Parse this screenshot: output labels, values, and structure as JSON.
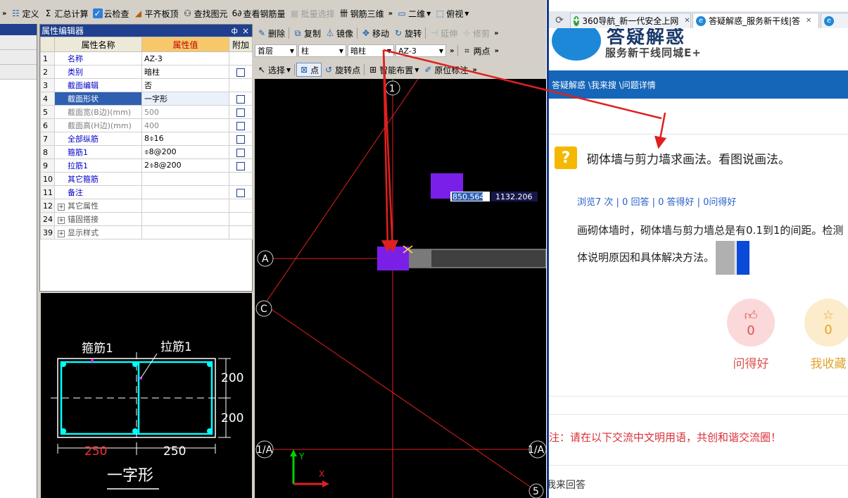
{
  "app": {
    "top_toolbar": {
      "chevron": "»",
      "define": "定义",
      "sum_calc": "汇总计算",
      "cloud_check": "云检查",
      "align_top": "平齐板顶",
      "find_element": "查找图元",
      "view_rebar_qty": "查看钢筋量",
      "batch_select": "批量选择",
      "rebar_3d": "钢筋三维",
      "view_2d": "二维",
      "top_view": "俯视"
    },
    "property_editor": {
      "title": "属性编辑器",
      "pin": "ф",
      "close": "×",
      "columns": [
        "属性名称",
        "属性值",
        "附加"
      ],
      "rows": [
        {
          "no": "1",
          "name": "名称",
          "value": "AZ-3",
          "check": false,
          "grey": false
        },
        {
          "no": "2",
          "name": "类别",
          "value": "暗柱",
          "check": true,
          "grey": false
        },
        {
          "no": "3",
          "name": "截面编辑",
          "value": "否",
          "check": false,
          "grey": false
        },
        {
          "no": "4",
          "name": "截面形状",
          "value": "一字形",
          "check": true,
          "grey": false,
          "selected": true
        },
        {
          "no": "5",
          "name": "截面宽(B边)(mm)",
          "value": "500",
          "check": true,
          "grey": true
        },
        {
          "no": "6",
          "name": "截面高(H边)(mm)",
          "value": "400",
          "check": true,
          "grey": true
        },
        {
          "no": "7",
          "name": "全部纵筋",
          "value": "8⌽16",
          "check": true,
          "grey": false
        },
        {
          "no": "8",
          "name": "箍筋1",
          "value": "⌽8@200",
          "check": true,
          "grey": false
        },
        {
          "no": "9",
          "name": "拉筋1",
          "value": "2⌽8@200",
          "check": true,
          "grey": false
        },
        {
          "no": "10",
          "name": "其它箍筋",
          "value": "",
          "check": false,
          "grey": false
        },
        {
          "no": "11",
          "name": "备注",
          "value": "",
          "check": true,
          "grey": false
        }
      ],
      "groups": [
        {
          "no": "12",
          "name": "其它属性"
        },
        {
          "no": "24",
          "name": "锚固搭接"
        },
        {
          "no": "39",
          "name": "显示样式"
        }
      ]
    },
    "preview": {
      "label_stirrup": "箍筋1",
      "label_tie": "拉筋1",
      "dim_h1": "200",
      "dim_h2": "200",
      "dim_w1": "250",
      "dim_w2": "250",
      "shape_name": "一字形"
    },
    "cad_toolbar": {
      "delete": "删除",
      "copy": "复制",
      "mirror": "镜像",
      "move": "移动",
      "rotate": "旋转",
      "extend": "延伸",
      "trim": "修剪",
      "floor": "首层",
      "element_type": "柱",
      "sub_type": "暗柱",
      "component": "AZ-3",
      "two_points": "两点",
      "select": "选择",
      "point": "点",
      "rotate_point": "旋转点",
      "smart_place": "智能布置",
      "origin_mark": "原位标注"
    },
    "canvas": {
      "axis_1": "1",
      "axis_A": "A",
      "axis_C": "C",
      "axis_1A": "1/A",
      "axis_5": "5",
      "coord_x": "850.564",
      "coord_y": "1132.206",
      "ucs_y": "Y",
      "ucs_x": "X"
    }
  },
  "browser": {
    "tabs": [
      {
        "label": "360导航_新一代安全上网"
      },
      {
        "label": "答疑解惑_服务新干线|答"
      },
      {
        "label": ""
      }
    ],
    "site_title": "答疑解惑",
    "site_subtitle": "服务新干线同城E+",
    "breadcrumb": "答疑解惑 \\我来搜 \\问题详情",
    "question_title": "砌体墙与剪力墙求画法。看图说画法。",
    "stats": "浏览7 次 | 0 回答 | 0 答得好 | 0问得好",
    "desc_line1": "画砌体墙时，砌体墙与剪力墙总是有0.1到1的间距。检测",
    "desc_line2": "体说明原因和具体解决方法。",
    "good_count": "0",
    "good_label": "问得好",
    "fav_count": "0",
    "fav_label": "我收藏",
    "notice": "注：请在以下交流中文明用语，共创和谐交流圈！",
    "answer_tab": "我来回答"
  },
  "colors": {
    "annotation_arrow": "#e02020",
    "column_fill": "#7a1fe8",
    "site_blue": "#1565b8",
    "question_yellow": "#f5b800"
  }
}
